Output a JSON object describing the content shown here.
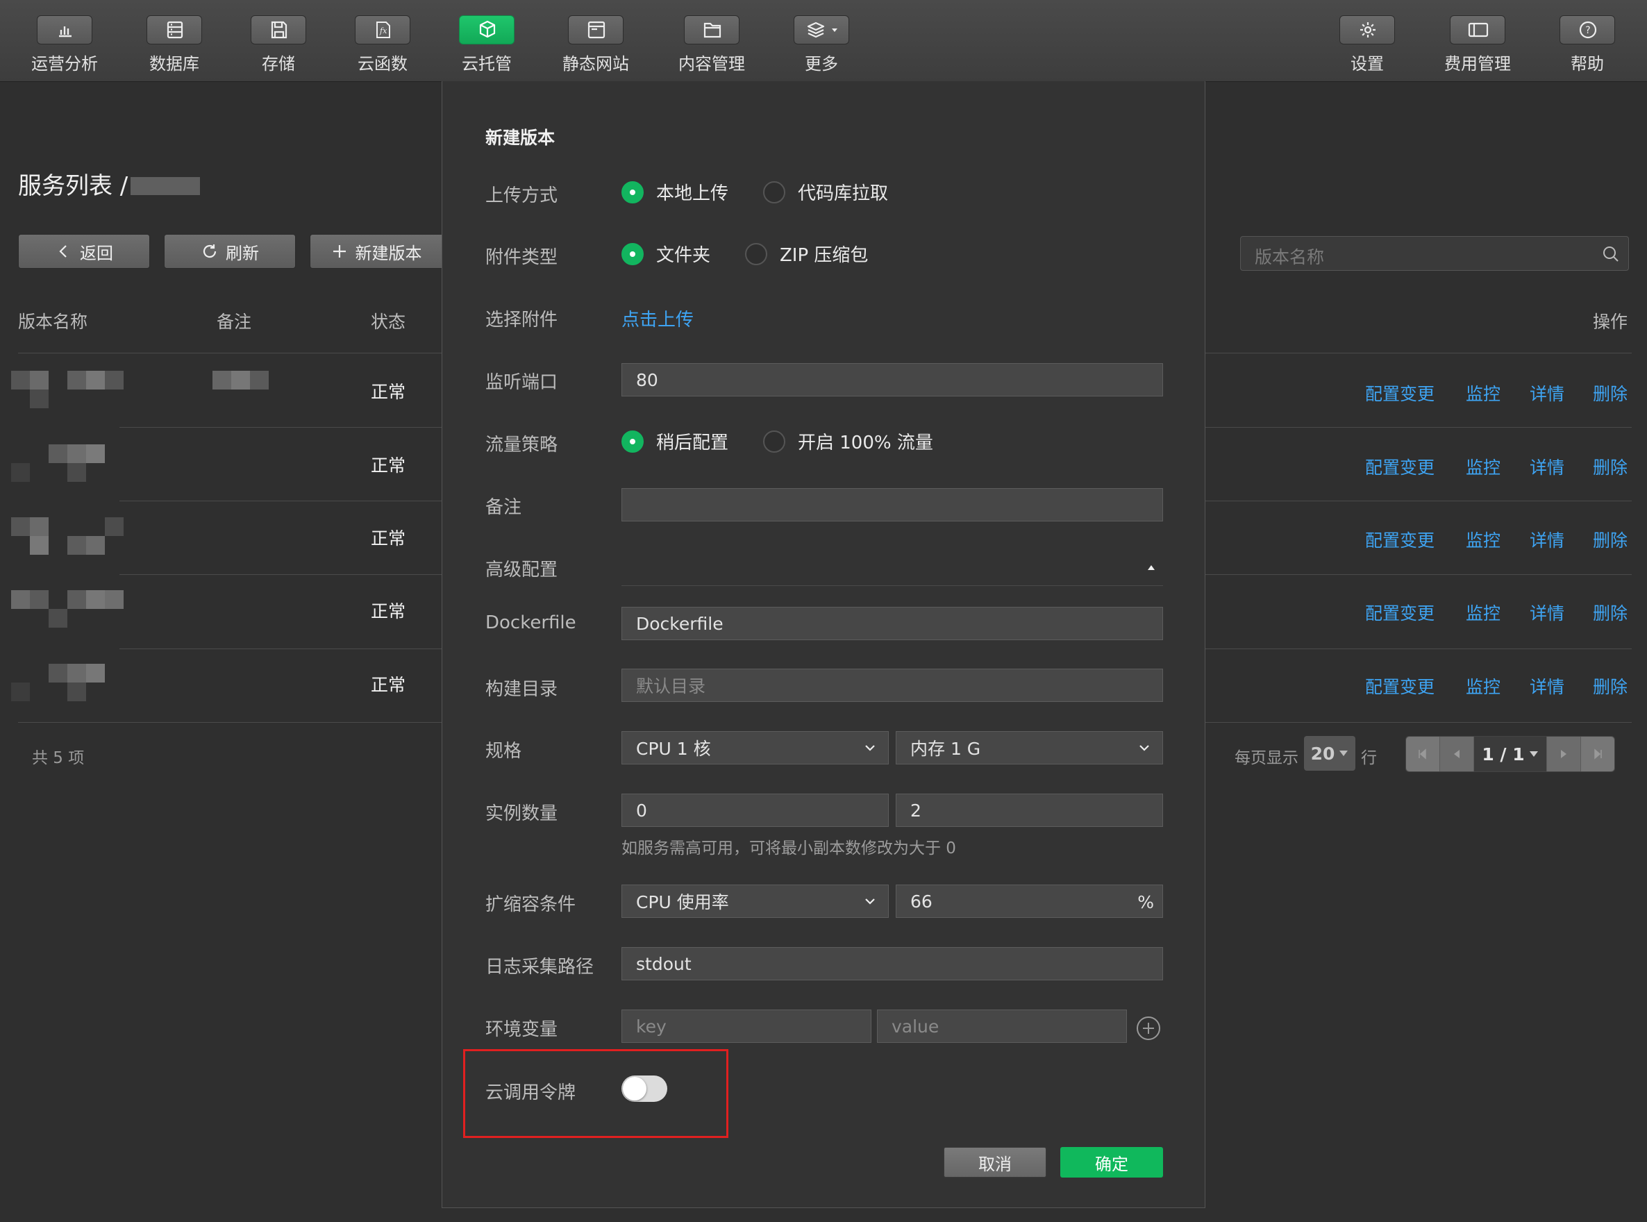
{
  "toolbar": {
    "left": [
      {
        "label": "运营分析",
        "icon": "bar-chart-icon"
      },
      {
        "label": "数据库",
        "icon": "database-icon"
      },
      {
        "label": "存储",
        "icon": "save-icon"
      },
      {
        "label": "云函数",
        "icon": "function-icon"
      },
      {
        "label": "云托管",
        "icon": "cube-icon",
        "active": true
      },
      {
        "label": "静态网站",
        "icon": "browser-window-icon"
      },
      {
        "label": "内容管理",
        "icon": "folder-icon"
      },
      {
        "label": "更多",
        "icon": "layers-icon"
      }
    ],
    "right": [
      {
        "label": "设置",
        "icon": "gear-icon"
      },
      {
        "label": "费用管理",
        "icon": "ticket-icon"
      },
      {
        "label": "帮助",
        "icon": "help-icon"
      }
    ]
  },
  "page": {
    "breadcrumb": "服务列表 /",
    "back_label": "返回",
    "refresh_label": "刷新",
    "new_version_label": "新建版本",
    "search_placeholder": "版本名称",
    "columns": {
      "name": "版本名称",
      "note": "备注",
      "status": "状态",
      "actions": "操作"
    },
    "rows": [
      {
        "status": "正常"
      },
      {
        "status": "正常"
      },
      {
        "status": "正常"
      },
      {
        "status": "正常"
      },
      {
        "status": "正常"
      }
    ],
    "row_actions": [
      "配置变更",
      "监控",
      "详情",
      "删除"
    ],
    "total": "共 5 项",
    "per_page_label": "每页显示",
    "page_size": "20",
    "rows_label": "行",
    "page_indicator": "1 / 1"
  },
  "dialog": {
    "title": "新建版本",
    "upload_method": {
      "label": "上传方式",
      "options": [
        "本地上传",
        "代码库拉取"
      ],
      "selected": "本地上传"
    },
    "attachment_type": {
      "label": "附件类型",
      "options": [
        "文件夹",
        "ZIP 压缩包"
      ],
      "selected": "文件夹"
    },
    "choose_attachment": {
      "label": "选择附件",
      "link": "点击上传"
    },
    "port": {
      "label": "监听端口",
      "value": "80"
    },
    "traffic": {
      "label": "流量策略",
      "options": [
        "稍后配置",
        "开启 100% 流量"
      ],
      "selected": "稍后配置"
    },
    "note": {
      "label": "备注",
      "value": ""
    },
    "advanced": {
      "label": "高级配置"
    },
    "dockerfile": {
      "label": "Dockerfile",
      "value": "Dockerfile"
    },
    "build_dir": {
      "label": "构建目录",
      "placeholder": "默认目录"
    },
    "spec": {
      "label": "规格",
      "cpu": "CPU 1 核",
      "memory": "内存 1 G"
    },
    "instances": {
      "label": "实例数量",
      "min": "0",
      "max": "2",
      "hint": "如服务需高可用，可将最小副本数修改为大于 0"
    },
    "scaling": {
      "label": "扩缩容条件",
      "metric": "CPU 使用率",
      "value": "66",
      "unit": "%"
    },
    "log_path": {
      "label": "日志采集路径",
      "value": "stdout"
    },
    "env": {
      "label": "环境变量",
      "key_placeholder": "key",
      "value_placeholder": "value"
    },
    "cloud_token": {
      "label": "云调用令牌",
      "enabled": false
    },
    "cancel_label": "取消",
    "ok_label": "确定"
  },
  "colors": {
    "accent": "#12b55f",
    "link": "#3ea4f3",
    "highlight": "#e02020"
  }
}
